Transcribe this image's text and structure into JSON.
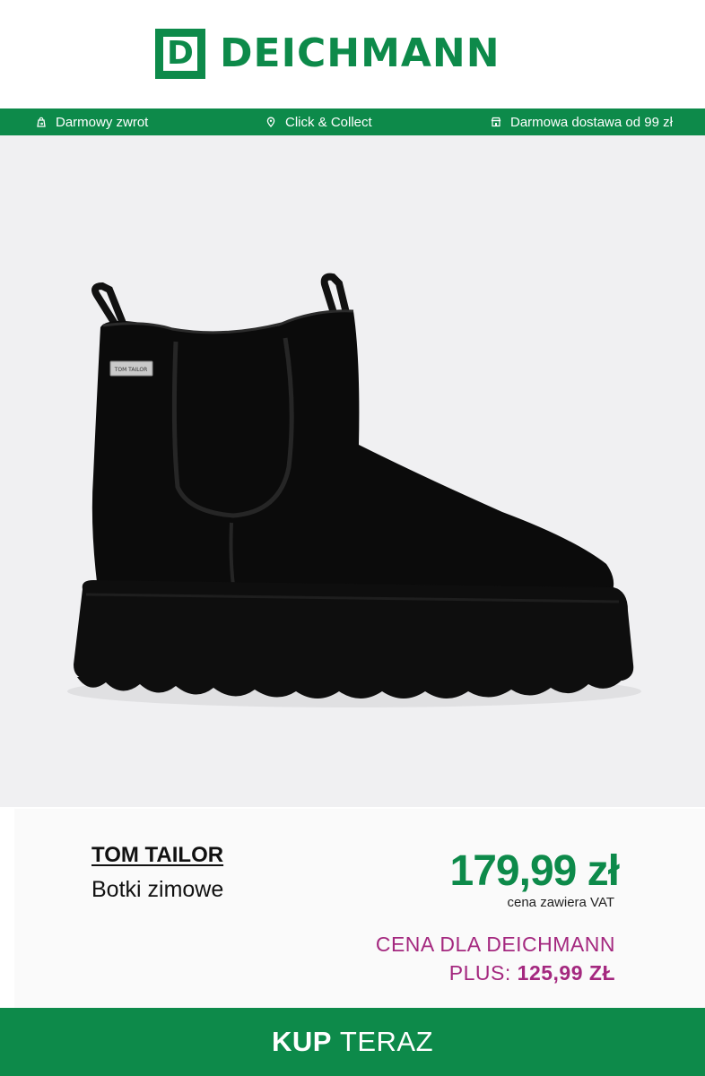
{
  "header": {
    "logo_letter": "D",
    "logo_text": "DEICHMANN",
    "brand_color": "#0d8a4a"
  },
  "infobar": {
    "items": [
      {
        "icon": "bag-return-icon",
        "label": "Darmowy zwrot"
      },
      {
        "icon": "location-pin-icon",
        "label": "Click & Collect"
      },
      {
        "icon": "store-icon",
        "label": "Darmowa dostawa od 99 zł"
      }
    ]
  },
  "product": {
    "image_label": "TOM TAILOR",
    "brand": "TOM TAILOR",
    "name": "Botki zimowe",
    "price": "179,99 zł",
    "vat_note": "cena zawiera VAT",
    "plus_line1": "CENA DLA DEICHMANN",
    "plus_line2_prefix": "PLUS:",
    "plus_price": "125,99 ZŁ",
    "plus_color": "#a4287f"
  },
  "cta": {
    "bold": "KUP",
    "rest": "TERAZ"
  }
}
